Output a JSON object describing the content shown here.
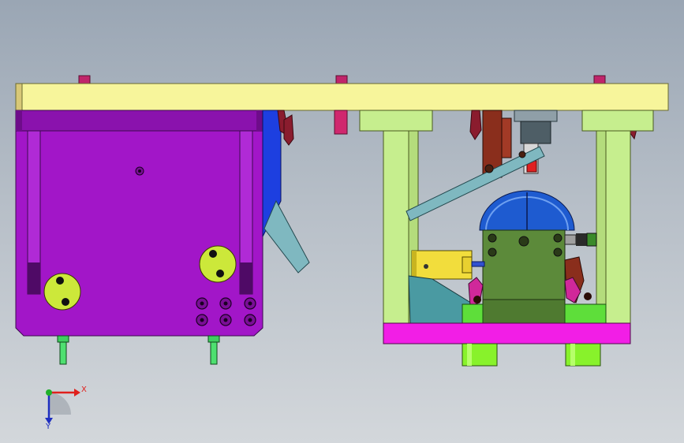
{
  "viewport": {
    "background_top": "#9aa6b4",
    "background_bottom": "#d3d7db"
  },
  "triad": {
    "x_label": "X",
    "y_label": "Y",
    "x_color": "#e0201c",
    "y_color": "#1f2fc0",
    "z_color": "#1fb02a"
  },
  "colors": {
    "top_plate": "#f7f59b",
    "left_block": "#a216c8",
    "frame": "#c6ee8e",
    "base_plate": "#f21ee6",
    "feet": "#88f22b",
    "screw_heads": "#c0246a",
    "link_arm": "#7fb8c0",
    "blue_part": "#1d3fe0",
    "motor_body": "#5c8a3a",
    "dome": "#1e5bd0",
    "brown_parts": "#8a2e1c",
    "cylinder": "#f2dd3c"
  }
}
